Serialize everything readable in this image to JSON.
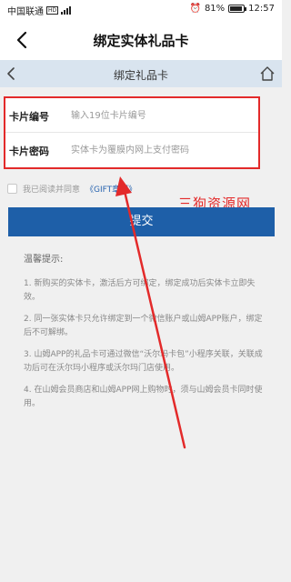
{
  "status_bar": {
    "carrier": "中国联通",
    "network_badge": "HD",
    "battery": "81%",
    "battery_level": 0.81,
    "time": "12:57"
  },
  "nav": {
    "title": "绑定实体礼品卡",
    "back_icon": "chevron-left-icon"
  },
  "inner_header": {
    "title": "绑定礼品卡",
    "back_icon": "chevron-left-icon",
    "home_icon": "home-icon",
    "background": "#d9e4ef"
  },
  "form": {
    "card_number_label": "卡片编号",
    "card_number_placeholder": "输入19位卡片编号",
    "card_number_value": "",
    "card_password_label": "卡片密码",
    "card_password_placeholder": "实体卡为覆膜内网上支付密码",
    "card_password_value": "",
    "highlight_color": "#e32a2a"
  },
  "agreement": {
    "text": "我已阅读并同意",
    "link": "《GIFT章程》",
    "checked": false
  },
  "watermark": "三狗资源网",
  "submit": {
    "label": "提交",
    "color": "#1e5fa8"
  },
  "tips": {
    "title": "温馨提示:",
    "items": [
      "1. 新购买的实体卡，激活后方可绑定，绑定成功后实体卡立即失效。",
      "2. 同一张实体卡只允许绑定到一个微信账户或山姆APP账户，绑定后不可解绑。",
      "3. 山姆APP的礼品卡可通过微信“沃尔玛卡包”小程序关联，关联成功后可在沃尔玛小程序或沃尔玛门店使用。",
      "4. 在山姆会员商店和山姆APP网上购物时，须与山姆会员卡同时使用。"
    ]
  },
  "annotation": {
    "arrow_color": "#e32a2a"
  }
}
